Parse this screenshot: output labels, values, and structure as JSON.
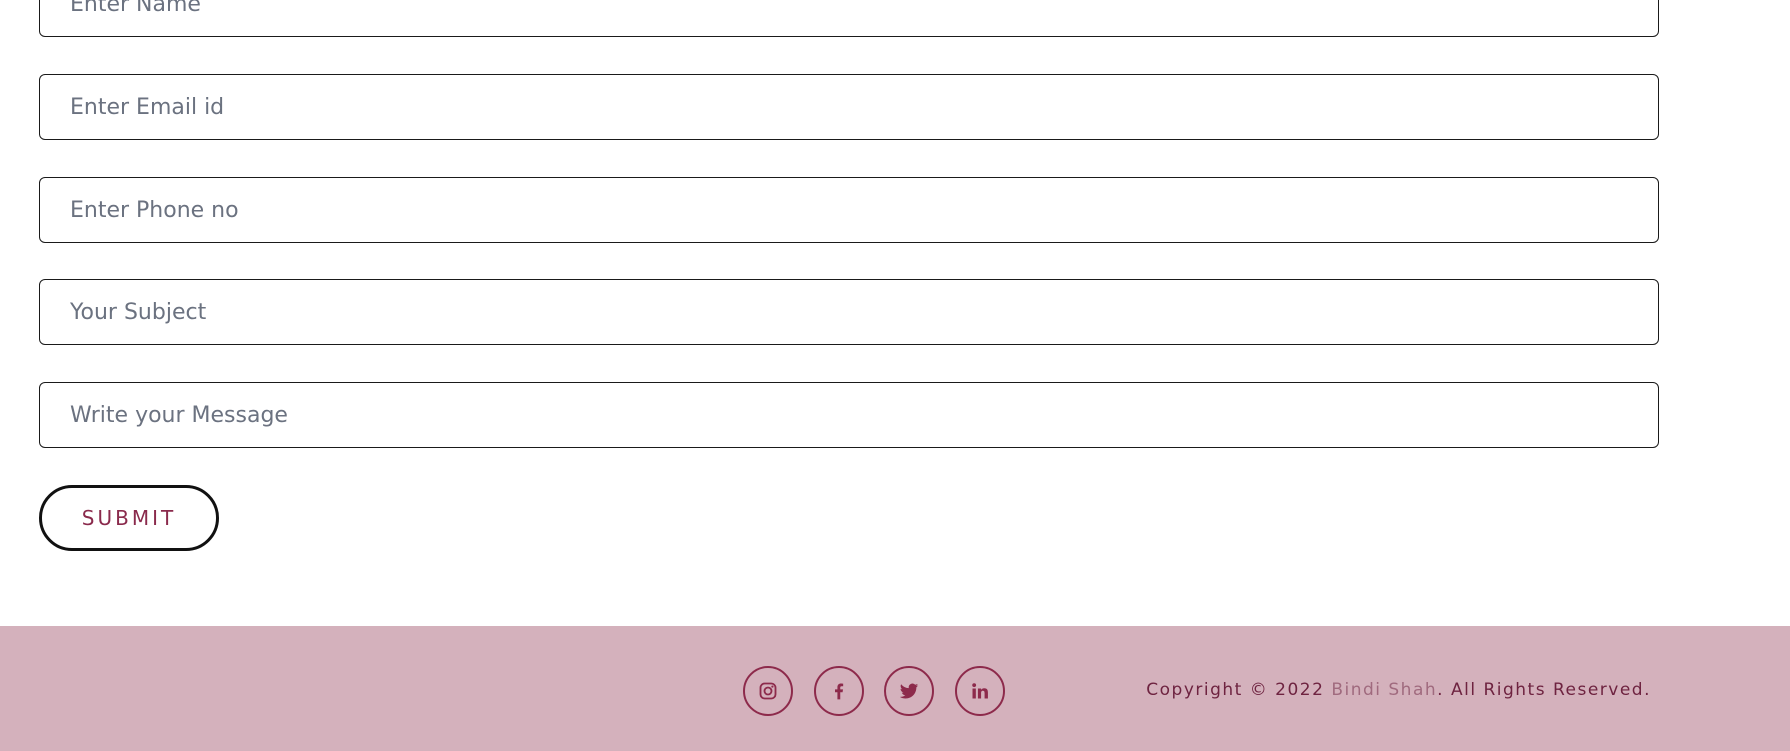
{
  "form": {
    "name_placeholder": "Enter Name",
    "email_placeholder": "Enter Email id",
    "phone_placeholder": "Enter Phone no",
    "subject_placeholder": "Your Subject",
    "message_placeholder": "Write your Message",
    "submit_label": "SUBMIT"
  },
  "footer": {
    "social_icons": [
      "instagram-icon",
      "facebook-icon",
      "twitter-icon",
      "linkedin-icon"
    ],
    "copyright_prefix": "Copyright © 2022 ",
    "brand_name": "Bindi Shah",
    "copyright_suffix": ". All Rights Reserved."
  },
  "colors": {
    "accent": "#8d2a4b",
    "footer_bg": "#d4b1bc",
    "brand_link": "#a06a7e"
  }
}
